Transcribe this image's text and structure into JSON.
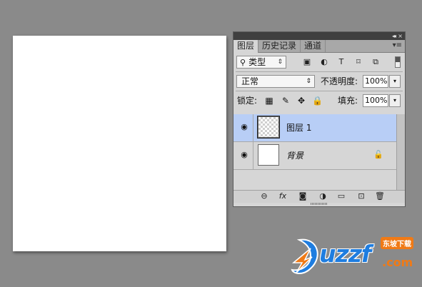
{
  "panel": {
    "collapse_glyph": "◂◂",
    "close_glyph": "×",
    "menu_glyph": "▾≡",
    "tabs": [
      {
        "label": "图层",
        "active": true
      },
      {
        "label": "历史记录",
        "active": false
      },
      {
        "label": "通道",
        "active": false
      }
    ]
  },
  "filter": {
    "kind_label": "类型",
    "search_glyph": "⚲",
    "arrow_glyph": "⇕",
    "icons": {
      "image": "▣",
      "adjustment": "◐",
      "type": "T",
      "shape": "⌑",
      "smart": "⧉"
    }
  },
  "blend": {
    "mode": "正常",
    "arrow_glyph": "⇕",
    "opacity_label": "不透明度:",
    "opacity_value": "100%"
  },
  "lock": {
    "label": "锁定:",
    "fill_label": "填充:",
    "fill_value": "100%",
    "icons": {
      "pixels": "▦",
      "paint": "✎",
      "move": "✥",
      "all": "🔒"
    }
  },
  "dropdown_glyph": "▾",
  "layers": [
    {
      "name": "图层 1",
      "selected": true,
      "visible": true,
      "transparent": true,
      "italic": false,
      "locked": false
    },
    {
      "name": "背景",
      "selected": false,
      "visible": true,
      "transparent": false,
      "italic": true,
      "locked": true
    }
  ],
  "eye_glyph": "◉",
  "lock_glyph": "🔓",
  "bottom_icons": {
    "link": "⊖",
    "fx": "fx",
    "mask": "◙",
    "adjust": "◑",
    "group": "▭",
    "new": "⊡",
    "delete": "🗑"
  },
  "watermark": {
    "text": "uzzf",
    "badge": "东坡下载",
    "com": ".com"
  }
}
